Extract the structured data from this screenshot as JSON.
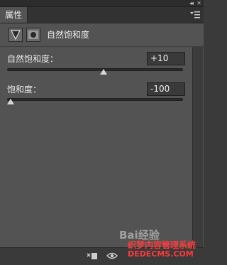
{
  "window": {
    "collapse_glyph": "◂◂",
    "close_glyph": "✕"
  },
  "panel": {
    "tab_label": "属性",
    "title": "自然饱和度"
  },
  "adjustments": [
    {
      "label": "自然饱和度：",
      "value": "+10",
      "slider_fraction": 0.55
    },
    {
      "label": "饱和度：",
      "value": "-100",
      "slider_fraction": 0.0
    }
  ],
  "watermark": {
    "logo_text": "Bai经验",
    "line1": "织梦内容管理系统",
    "line2": "DEDECMS.COM"
  },
  "icons": {
    "adjustment": "triangle-down-icon",
    "mask": "mask-icon",
    "menu": "panel-menu-icon",
    "clip": "clip-to-layer-icon",
    "visibility": "eye-icon"
  }
}
